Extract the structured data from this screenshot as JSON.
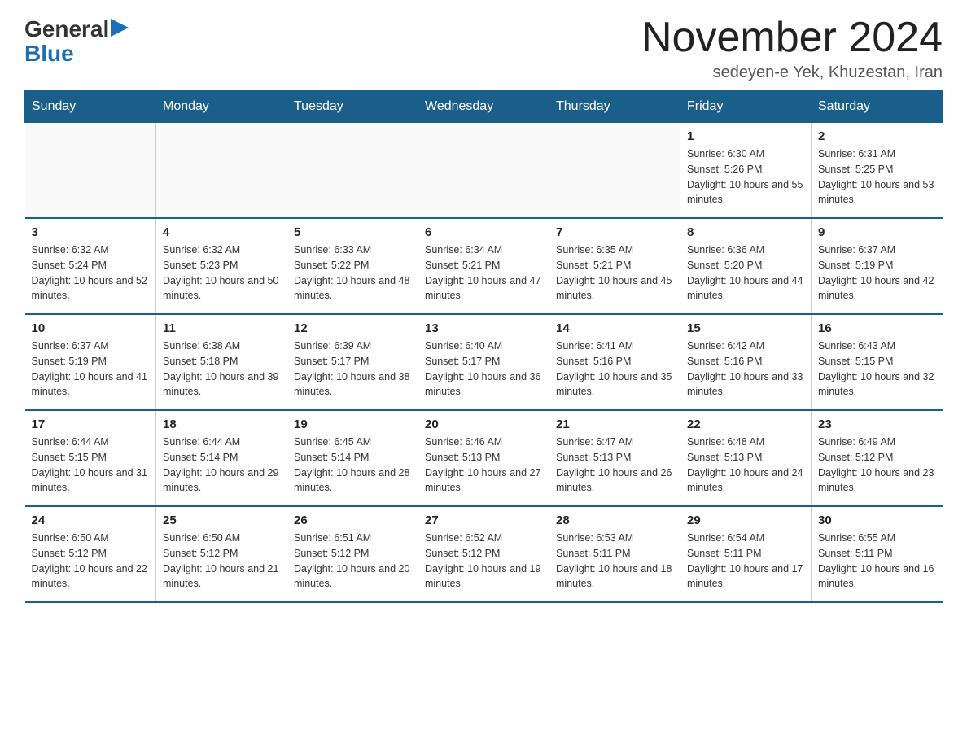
{
  "logo": {
    "general": "General",
    "blue": "Blue"
  },
  "title": {
    "month_year": "November 2024",
    "location": "sedeyen-e Yek, Khuzestan, Iran"
  },
  "weekdays": [
    "Sunday",
    "Monday",
    "Tuesday",
    "Wednesday",
    "Thursday",
    "Friday",
    "Saturday"
  ],
  "weeks": [
    [
      {
        "day": "",
        "info": ""
      },
      {
        "day": "",
        "info": ""
      },
      {
        "day": "",
        "info": ""
      },
      {
        "day": "",
        "info": ""
      },
      {
        "day": "",
        "info": ""
      },
      {
        "day": "1",
        "info": "Sunrise: 6:30 AM\nSunset: 5:26 PM\nDaylight: 10 hours and 55 minutes."
      },
      {
        "day": "2",
        "info": "Sunrise: 6:31 AM\nSunset: 5:25 PM\nDaylight: 10 hours and 53 minutes."
      }
    ],
    [
      {
        "day": "3",
        "info": "Sunrise: 6:32 AM\nSunset: 5:24 PM\nDaylight: 10 hours and 52 minutes."
      },
      {
        "day": "4",
        "info": "Sunrise: 6:32 AM\nSunset: 5:23 PM\nDaylight: 10 hours and 50 minutes."
      },
      {
        "day": "5",
        "info": "Sunrise: 6:33 AM\nSunset: 5:22 PM\nDaylight: 10 hours and 48 minutes."
      },
      {
        "day": "6",
        "info": "Sunrise: 6:34 AM\nSunset: 5:21 PM\nDaylight: 10 hours and 47 minutes."
      },
      {
        "day": "7",
        "info": "Sunrise: 6:35 AM\nSunset: 5:21 PM\nDaylight: 10 hours and 45 minutes."
      },
      {
        "day": "8",
        "info": "Sunrise: 6:36 AM\nSunset: 5:20 PM\nDaylight: 10 hours and 44 minutes."
      },
      {
        "day": "9",
        "info": "Sunrise: 6:37 AM\nSunset: 5:19 PM\nDaylight: 10 hours and 42 minutes."
      }
    ],
    [
      {
        "day": "10",
        "info": "Sunrise: 6:37 AM\nSunset: 5:19 PM\nDaylight: 10 hours and 41 minutes."
      },
      {
        "day": "11",
        "info": "Sunrise: 6:38 AM\nSunset: 5:18 PM\nDaylight: 10 hours and 39 minutes."
      },
      {
        "day": "12",
        "info": "Sunrise: 6:39 AM\nSunset: 5:17 PM\nDaylight: 10 hours and 38 minutes."
      },
      {
        "day": "13",
        "info": "Sunrise: 6:40 AM\nSunset: 5:17 PM\nDaylight: 10 hours and 36 minutes."
      },
      {
        "day": "14",
        "info": "Sunrise: 6:41 AM\nSunset: 5:16 PM\nDaylight: 10 hours and 35 minutes."
      },
      {
        "day": "15",
        "info": "Sunrise: 6:42 AM\nSunset: 5:16 PM\nDaylight: 10 hours and 33 minutes."
      },
      {
        "day": "16",
        "info": "Sunrise: 6:43 AM\nSunset: 5:15 PM\nDaylight: 10 hours and 32 minutes."
      }
    ],
    [
      {
        "day": "17",
        "info": "Sunrise: 6:44 AM\nSunset: 5:15 PM\nDaylight: 10 hours and 31 minutes."
      },
      {
        "day": "18",
        "info": "Sunrise: 6:44 AM\nSunset: 5:14 PM\nDaylight: 10 hours and 29 minutes."
      },
      {
        "day": "19",
        "info": "Sunrise: 6:45 AM\nSunset: 5:14 PM\nDaylight: 10 hours and 28 minutes."
      },
      {
        "day": "20",
        "info": "Sunrise: 6:46 AM\nSunset: 5:13 PM\nDaylight: 10 hours and 27 minutes."
      },
      {
        "day": "21",
        "info": "Sunrise: 6:47 AM\nSunset: 5:13 PM\nDaylight: 10 hours and 26 minutes."
      },
      {
        "day": "22",
        "info": "Sunrise: 6:48 AM\nSunset: 5:13 PM\nDaylight: 10 hours and 24 minutes."
      },
      {
        "day": "23",
        "info": "Sunrise: 6:49 AM\nSunset: 5:12 PM\nDaylight: 10 hours and 23 minutes."
      }
    ],
    [
      {
        "day": "24",
        "info": "Sunrise: 6:50 AM\nSunset: 5:12 PM\nDaylight: 10 hours and 22 minutes."
      },
      {
        "day": "25",
        "info": "Sunrise: 6:50 AM\nSunset: 5:12 PM\nDaylight: 10 hours and 21 minutes."
      },
      {
        "day": "26",
        "info": "Sunrise: 6:51 AM\nSunset: 5:12 PM\nDaylight: 10 hours and 20 minutes."
      },
      {
        "day": "27",
        "info": "Sunrise: 6:52 AM\nSunset: 5:12 PM\nDaylight: 10 hours and 19 minutes."
      },
      {
        "day": "28",
        "info": "Sunrise: 6:53 AM\nSunset: 5:11 PM\nDaylight: 10 hours and 18 minutes."
      },
      {
        "day": "29",
        "info": "Sunrise: 6:54 AM\nSunset: 5:11 PM\nDaylight: 10 hours and 17 minutes."
      },
      {
        "day": "30",
        "info": "Sunrise: 6:55 AM\nSunset: 5:11 PM\nDaylight: 10 hours and 16 minutes."
      }
    ]
  ]
}
